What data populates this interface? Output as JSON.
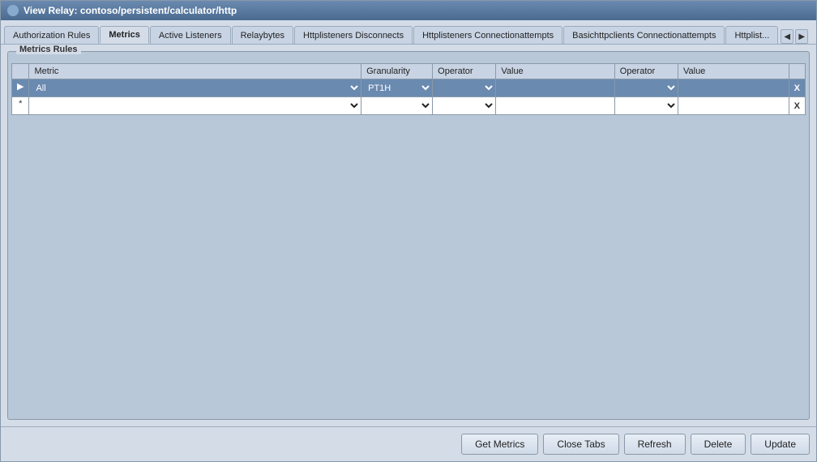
{
  "window": {
    "title": "View Relay: contoso/persistent/calculator/http"
  },
  "tabs": [
    {
      "label": "Authorization Rules",
      "active": false
    },
    {
      "label": "Metrics",
      "active": true
    },
    {
      "label": "Active Listeners",
      "active": false
    },
    {
      "label": "Relaybytes",
      "active": false
    },
    {
      "label": "Httplisteners Disconnects",
      "active": false
    },
    {
      "label": "Httplisteners Connectionattempts",
      "active": false
    },
    {
      "label": "Basichttpclients Connectionattempts",
      "active": false
    },
    {
      "label": "Httplist...",
      "active": false
    }
  ],
  "group_box": {
    "title": "Metrics Rules"
  },
  "table": {
    "headers": [
      {
        "label": "",
        "class": "col-arrow"
      },
      {
        "label": "Metric",
        "class": "col-metric"
      },
      {
        "label": "Granularity",
        "class": "col-granularity"
      },
      {
        "label": "Operator",
        "class": "col-operator1"
      },
      {
        "label": "Value",
        "class": "col-value1"
      },
      {
        "label": "Operator",
        "class": "col-operator2"
      },
      {
        "label": "Value",
        "class": "col-value2"
      },
      {
        "label": "",
        "class": "col-x"
      }
    ],
    "rows": [
      {
        "selected": true,
        "marker": "▶",
        "metric": "All",
        "granularity": "PT1H",
        "operator1": "",
        "value1": "",
        "operator2": "",
        "value2": "",
        "x": "X"
      },
      {
        "selected": false,
        "marker": "*",
        "metric": "",
        "granularity": "",
        "operator1": "",
        "value1": "",
        "operator2": "",
        "value2": "",
        "x": "X"
      }
    ]
  },
  "footer": {
    "buttons": [
      {
        "label": "Get Metrics",
        "name": "get-metrics-button"
      },
      {
        "label": "Close Tabs",
        "name": "close-tabs-button"
      },
      {
        "label": "Refresh",
        "name": "refresh-button"
      },
      {
        "label": "Delete",
        "name": "delete-button"
      },
      {
        "label": "Update",
        "name": "update-button"
      }
    ]
  }
}
